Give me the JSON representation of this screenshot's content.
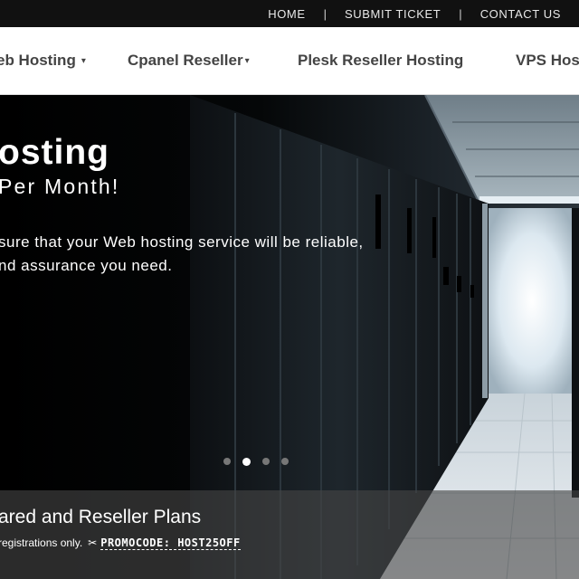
{
  "topbar": {
    "links": [
      "HOME",
      "SUBMIT TICKET",
      "CONTACT US"
    ],
    "separator": "|"
  },
  "nav": {
    "items": [
      "eb Hosting",
      "Cpanel Reseller",
      "Plesk Reseller Hosting",
      "VPS Hos"
    ],
    "caret": "▾"
  },
  "hero": {
    "title": "osting",
    "subtitle": "Per Month!",
    "desc_line1": "sure that your Web hosting service will be reliable,",
    "desc_line2": "nd assurance you need.",
    "slides": {
      "count": 4,
      "active_index": 1
    }
  },
  "plans": {
    "title": "ared and Reseller Plans",
    "note": "registrations only.",
    "scissors_icon": "✂",
    "promocode": "PROMOCODE: HOST25OFF"
  }
}
